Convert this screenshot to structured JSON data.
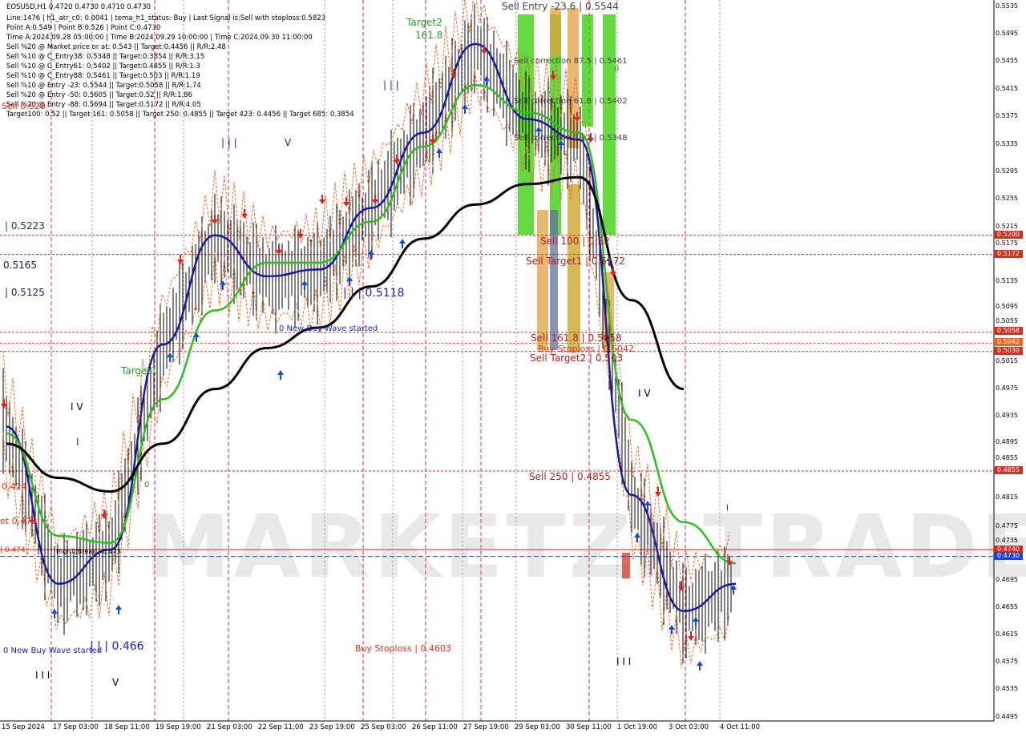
{
  "header": {
    "symbol_line": "EOSUSD,H1  0.4720 0.4730 0.4710 0.4730",
    "info_lines": [
      "Line:1476 | h1_atr_c0: 0.0041 | tema_h1_status: Buy | Last Signal is:Sell with stoploss:0.5823",
      "Point A:0.549 | Point B:0.526 | Point C:0.4730",
      "Time A:2024.09.28 05:00:00 | Time B:2024.09.29 10:00:00 | Time C:2024.09.30 11:00:00",
      "Sell %20 @ Market price or at: 0.543 || Target:0.4456 || R/R:2.48",
      "Sell %10 @ C_Entry38: 0.5348 || Target:0.3854 || R/R:3.15",
      "Sell %10 @ C_Entry61: 0.5402 || Target:0.4855 || R/R:1.3",
      "Sell %10 @ C_Entry88: 0.5461 || Target:0.503 || R/R:1.19",
      "Sell %10 @ Entry -23: 0.5544 || Target:0.5058 || R/R:1.74",
      "Sell %20 @ Entry -50: 0.5605 || Target:0.52 || R/R:1.86",
      "Sell %20 @ Entry -88: 0.5694 || Target:0.5172 || R/R:4.05",
      "Target100: 0.52 || Target 161: 0.5058 || Target 250: 0.4855 || Target 423: 0.4456 || Target 685: 0.3854"
    ]
  },
  "watermark": "MARKETZI TRADE",
  "labels": [
    {
      "name": "label-sell-entry",
      "text": "Sell Entry -23.6 | 0.5544",
      "color": "#444444",
      "size": 12
    },
    {
      "name": "label-sell-correction-875",
      "text": "Sell correction 87.5 | 0.5461",
      "color": "#444444",
      "size": 10
    },
    {
      "name": "label-sell-correction-618",
      "text": "Sell correction 61.8 | 0.5402",
      "color": "#444444",
      "size": 10
    },
    {
      "name": "label-sell-correction-382",
      "text": "Sell correction 38.2 | 0.5348",
      "color": "#444444",
      "size": 10
    },
    {
      "name": "label-sell-100",
      "text": "Sell 100 | 0.52",
      "color": "#b02020",
      "size": 12
    },
    {
      "name": "label-sell-target1",
      "text": "Sell Target1 | 0.5172",
      "color": "#b02020",
      "size": 12
    },
    {
      "name": "label-sell-1618",
      "text": "Sell 161.8 | 0.5058",
      "color": "#b02020",
      "size": 12
    },
    {
      "name": "label-buy-stoploss-right",
      "text": "Buy Stoploss | 0.5042",
      "color": "#e03020",
      "size": 11
    },
    {
      "name": "label-sell-target2",
      "text": "Sell Target2 | 0.503",
      "color": "#b02020",
      "size": 12
    },
    {
      "name": "label-sell-250",
      "text": "Sell 250 | 0.4855",
      "color": "#b02020",
      "size": 12
    },
    {
      "name": "label-buy-stoploss-left",
      "text": "Buy Stoploss | 0.4603",
      "color": "#e03020",
      "size": 11
    },
    {
      "name": "label-target2",
      "text": "Target2",
      "color": "#2a9a2a",
      "size": 12
    },
    {
      "name": "label-target2-value",
      "text": "161.8",
      "color": "#2a9a2a",
      "size": 12
    },
    {
      "name": "label-target1-green",
      "text": "Target1",
      "color": "#2a9a2a",
      "size": 12
    },
    {
      "name": "label-5223",
      "text": "| 0.5223",
      "color": "#1a4a1a",
      "size": 12
    },
    {
      "name": "label-5165",
      "text": "0.5165",
      "color": "#1a1a4a",
      "size": 12
    },
    {
      "name": "label-5125",
      "text": "| 0.5125",
      "color": "#1a1a4a",
      "size": 12
    },
    {
      "name": "label-5118",
      "text": "| | | 0.5118",
      "color": "#2020c0",
      "size": 14
    },
    {
      "name": "label-new-buy-wave-1",
      "text": "0 New Buy Wave started",
      "color": "#2020c0",
      "size": 10
    },
    {
      "name": "label-new-buy-wave-2",
      "text": "0 New Buy Wave started",
      "color": "#2020c0",
      "size": 10
    },
    {
      "name": "label-466",
      "text": "| | | 0.466",
      "color": "#2020c0",
      "size": 14
    },
    {
      "name": "label-wave-iii-top",
      "text": "| | |",
      "color": "#2020c0",
      "size": 12
    },
    {
      "name": "label-wave-iii-mid",
      "text": "| | |",
      "color": "#2020c0",
      "size": 12
    },
    {
      "name": "label-wave-v-blue",
      "text": "V",
      "color": "#2020c0",
      "size": 12
    },
    {
      "name": "label-wave-iv-left",
      "text": "I V",
      "color": "#000000",
      "size": 12
    },
    {
      "name": "label-wave-i-left",
      "text": "I",
      "color": "#2020c0",
      "size": 12
    },
    {
      "name": "label-wave-iii-bottom",
      "text": "I I I",
      "color": "#000000",
      "size": 12
    },
    {
      "name": "label-wave-v-bottom",
      "text": "V",
      "color": "#000000",
      "size": 12
    },
    {
      "name": "label-wave-iv-right",
      "text": "I V",
      "color": "#000000",
      "size": 12
    },
    {
      "name": "label-wave-iii-right",
      "text": "I I I",
      "color": "#000000",
      "size": 12
    },
    {
      "name": "label-wave-i-right",
      "text": "I",
      "color": "#2020c0",
      "size": 10
    },
    {
      "name": "label-zero-mid",
      "text": "0",
      "color": "#2a9a2a",
      "size": 10
    },
    {
      "name": "label-zero-top",
      "text": "0",
      "color": "#2a9a2a",
      "size": 10
    },
    {
      "name": "label-high-to-break",
      "text": "HighToBreak | 0.473",
      "color": "#000000",
      "size": 8
    },
    {
      "name": "label-left-0474",
      "text": "| 0.474",
      "color": "#e03020",
      "size": 9
    },
    {
      "name": "label-left-424",
      "text": "0.424",
      "color": "#e03020",
      "size": 11
    },
    {
      "name": "label-left-479",
      "text": "et 0.479",
      "color": "#e03020",
      "size": 11
    },
    {
      "name": "label-left-520",
      "text": "Sell 0.520",
      "color": "#e03020",
      "size": 11
    }
  ],
  "price_scale": [
    "0.5535",
    "0.5495",
    "0.5455",
    "0.5415",
    "0.5375",
    "0.5335",
    "0.5295",
    "0.5255",
    "0.5215",
    "0.5175",
    "0.5135",
    "0.5095",
    "0.5055",
    "0.5015",
    "0.4975",
    "0.4935",
    "0.4895",
    "0.4855",
    "0.4815",
    "0.4775",
    "0.4735",
    "0.4695",
    "0.4655",
    "0.4615",
    "0.4575",
    "0.4535",
    "0.4495"
  ],
  "price_tags": [
    {
      "name": "tag-5200",
      "text": "0.5200",
      "color": "#cc3322"
    },
    {
      "name": "tag-5172",
      "text": "0.5172",
      "color": "#cc3322"
    },
    {
      "name": "tag-5058",
      "text": "0.5058",
      "color": "#cc3322"
    },
    {
      "name": "tag-5042",
      "text": "0.5042",
      "color": "#ee6622"
    },
    {
      "name": "tag-5030",
      "text": "0.5030",
      "color": "#cc3322"
    },
    {
      "name": "tag-4855",
      "text": "0.4855",
      "color": "#cc3322"
    },
    {
      "name": "tag-4740",
      "text": "0.4740",
      "color": "#dd2222"
    },
    {
      "name": "tag-4730",
      "text": "0.4730",
      "color": "#2244cc"
    }
  ],
  "dates": [
    "15 Sep 2024",
    "17 Sep 03:00",
    "18 Sep 11:00",
    "19 Sep 19:00",
    "21 Sep 03:00",
    "22 Sep 11:00",
    "23 Sep 19:00",
    "25 Sep 03:00",
    "26 Sep 11:00",
    "27 Sep 19:00",
    "29 Sep 03:00",
    "30 Sep 11:00",
    "1 Oct 19:00",
    "3 Oct 03:00",
    "4 Oct 11:00"
  ],
  "chart_data": {
    "type": "line",
    "y_range": [
      0.4495,
      0.5535
    ],
    "horizontal_levels": [
      {
        "name": "Sell 100",
        "value": 0.52,
        "color": "#cc3322"
      },
      {
        "name": "Sell Target1",
        "value": 0.5172,
        "color": "#cc3322"
      },
      {
        "name": "Sell 161.8",
        "value": 0.5058,
        "color": "#cc3322"
      },
      {
        "name": "Buy Stoploss",
        "value": 0.5042,
        "color": "#ee6622"
      },
      {
        "name": "Sell Target2",
        "value": 0.503,
        "color": "#cc3322"
      },
      {
        "name": "Sell 250",
        "value": 0.4855,
        "color": "#cc3322"
      },
      {
        "name": "High",
        "value": 0.474,
        "color": "#dd2222"
      },
      {
        "name": "Close",
        "value": 0.473,
        "color": "#2244cc"
      }
    ],
    "x": [
      "15 Sep 2024",
      "17 Sep 03:00",
      "18 Sep 11:00",
      "19 Sep 19:00",
      "21 Sep 03:00",
      "22 Sep 11:00",
      "23 Sep 19:00",
      "25 Sep 03:00",
      "26 Sep 11:00",
      "27 Sep 19:00",
      "29 Sep 03:00",
      "30 Sep 11:00",
      "1 Oct 19:00",
      "3 Oct 03:00",
      "4 Oct 11:00"
    ],
    "series": [
      {
        "color": "#1a1aa0",
        "values": [
          0.492,
          0.469,
          0.474,
          0.504,
          0.52,
          0.514,
          0.515,
          0.524,
          0.535,
          0.548,
          0.537,
          0.534,
          0.482,
          0.465,
          0.469
        ]
      },
      {
        "color": "#33bb22",
        "values": [
          0.491,
          0.476,
          0.475,
          0.496,
          0.509,
          0.516,
          0.516,
          0.522,
          0.533,
          0.542,
          0.538,
          0.535,
          0.493,
          0.478,
          0.472
        ]
      },
      {
        "color": "#000000",
        "values": [
          0.4895,
          0.4845,
          0.4825,
          0.4895,
          0.4975,
          0.5035,
          0.5065,
          0.5125,
          0.5195,
          0.5245,
          0.5275,
          0.5285,
          0.5105,
          0.4975
        ]
      }
    ]
  }
}
